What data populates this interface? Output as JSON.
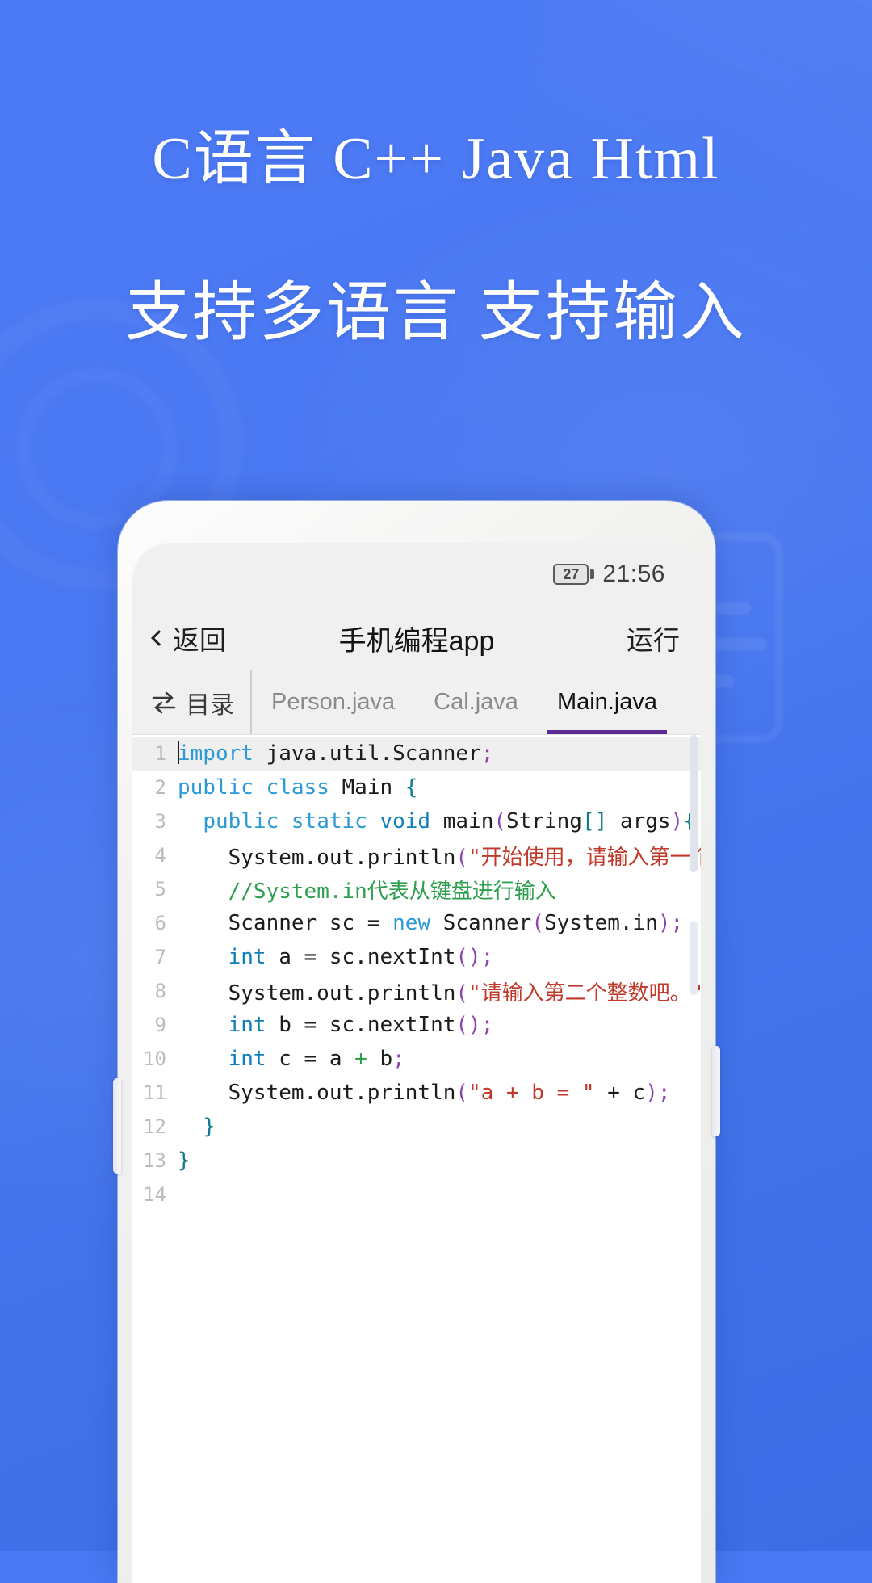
{
  "theme": {
    "bg_blue": "#4878f3",
    "accent_purple": "#5c2d91",
    "keyword_blue": "#2c9ad4",
    "string_red": "#c0392b",
    "comment_green": "#2e9e4f",
    "paren_purple": "#8e44ad"
  },
  "headlines": {
    "line1": "C语言 C++ Java Html",
    "line2": "支持多语言 支持输入"
  },
  "phone": {
    "statusbar": {
      "battery_level": "27",
      "clock": "21:56"
    },
    "navbar": {
      "back_label": "返回",
      "title": "手机编程app",
      "run_label": "运行"
    },
    "tabbar": {
      "directory_label": "目录",
      "directory_icon": "swap-icon",
      "tabs": [
        {
          "label": "Person.java",
          "active": false
        },
        {
          "label": "Cal.java",
          "active": false
        },
        {
          "label": "Main.java",
          "active": true
        }
      ]
    },
    "editor": {
      "language": "java",
      "active_file": "Main.java",
      "line_numbers": [
        "1",
        "2",
        "3",
        "4",
        "5",
        "6",
        "7",
        "8",
        "9",
        "10",
        "11",
        "12",
        "13",
        "14"
      ],
      "lines": [
        "import java.util.Scanner;",
        "public class Main {",
        "  public static void main(String[] args){",
        "    System.out.println(\"开始使用，请输入第一个整数吧。\");",
        "    //System.in代表从键盘进行输入",
        "    Scanner sc = new Scanner(System.in);",
        "    int a = sc.nextInt();",
        "    System.out.println(\"请输入第二个整数吧。\");",
        "    int b = sc.nextInt();",
        "    int c = a + b;",
        "    System.out.println(\"a + b = \" + c);",
        "  }",
        "}",
        ""
      ]
    }
  }
}
